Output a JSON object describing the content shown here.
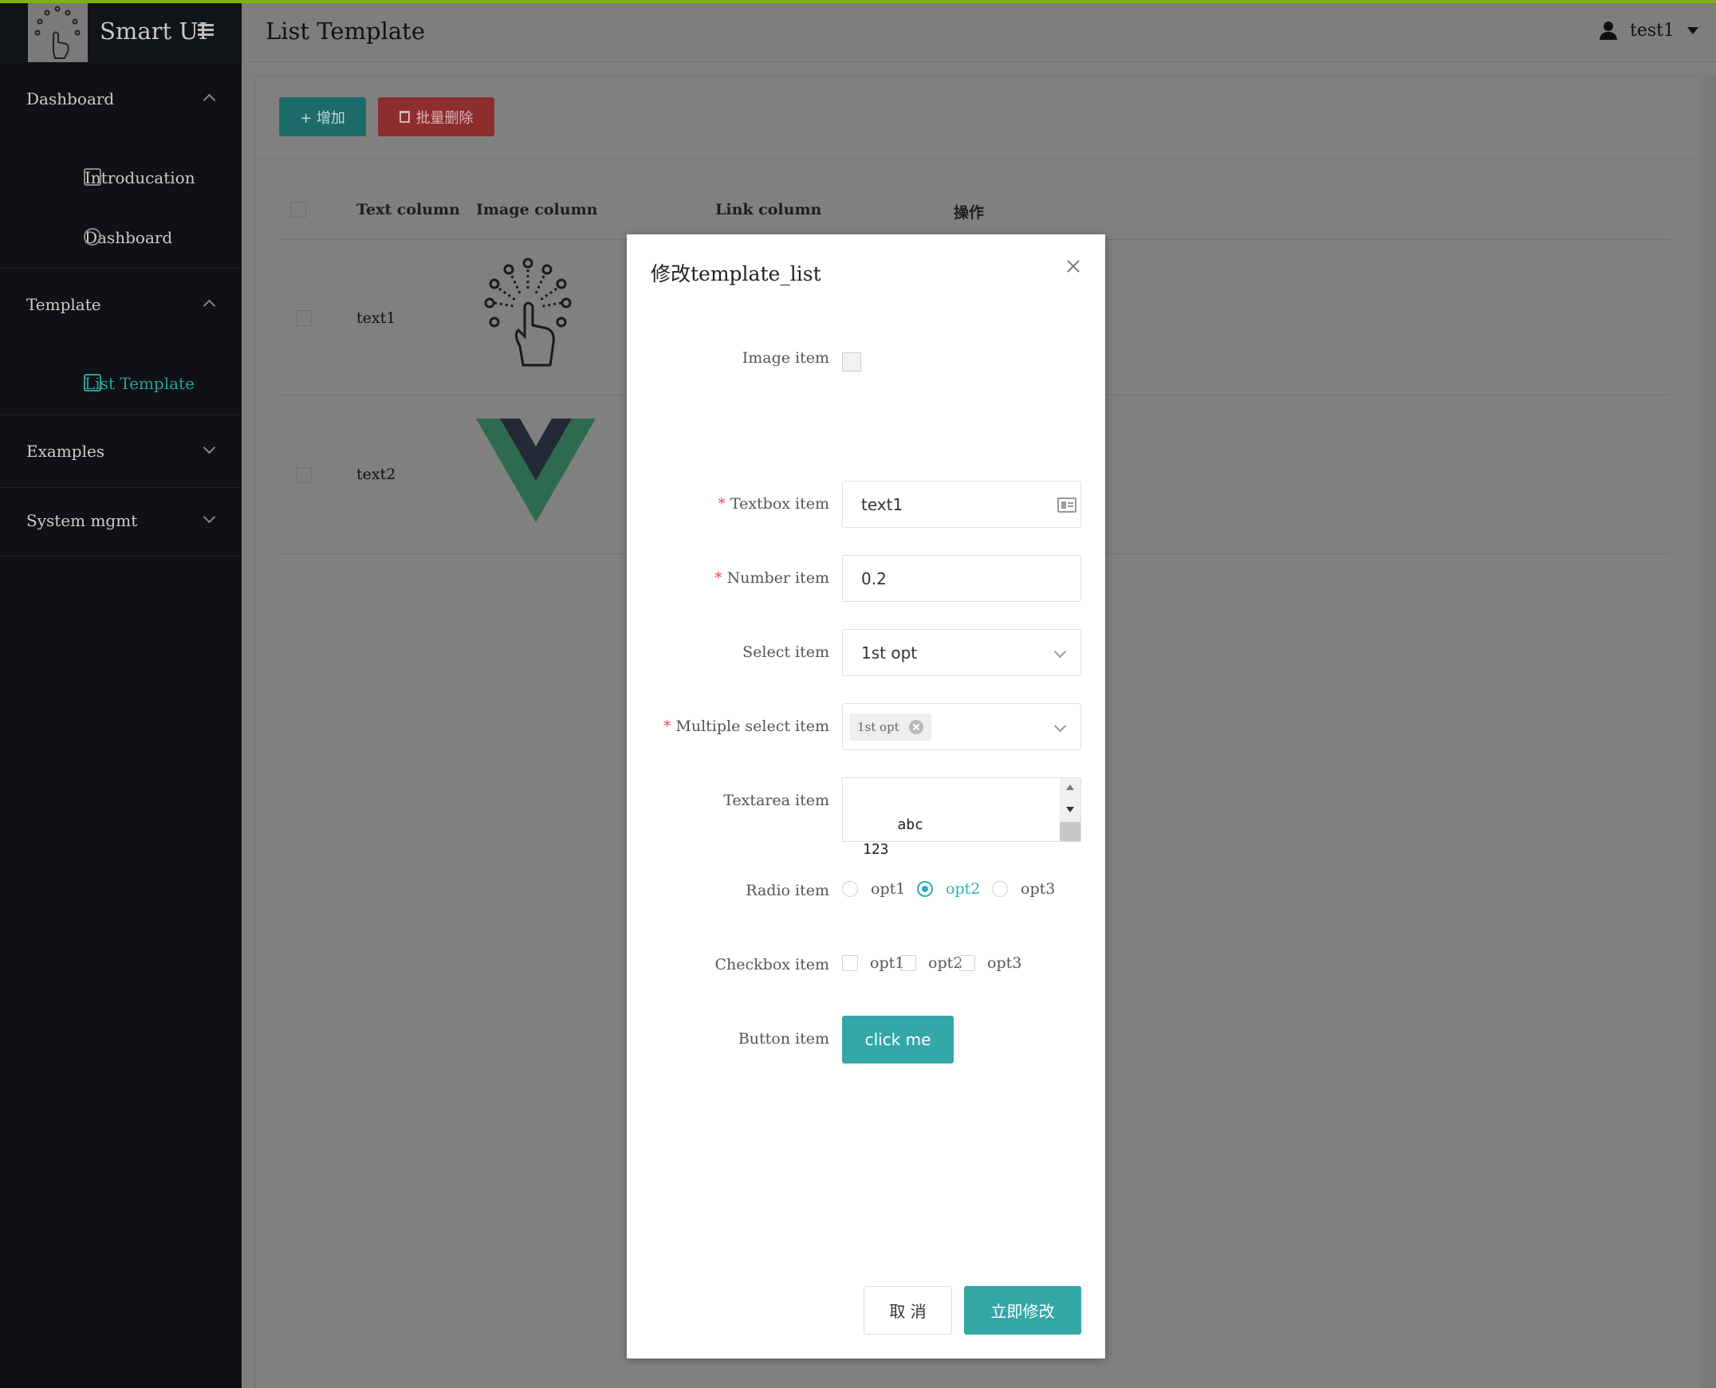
{
  "app": {
    "title": "Smart UI"
  },
  "sidebar": {
    "groups": [
      {
        "label": "Dashboard",
        "expanded": true,
        "items": [
          {
            "label": "Introducation",
            "icon": "presentation-chart-icon"
          },
          {
            "label": "Dashboard",
            "icon": "gauge-icon"
          }
        ]
      },
      {
        "label": "Template",
        "expanded": true,
        "items": [
          {
            "label": "List Template",
            "icon": "book-icon",
            "active": true
          }
        ]
      },
      {
        "label": "Examples",
        "expanded": false,
        "items": []
      },
      {
        "label": "System mgmt",
        "expanded": false,
        "items": []
      }
    ]
  },
  "header": {
    "page_title": "List Template",
    "user_name": "test1"
  },
  "toolbar": {
    "add_label": "+ 增加",
    "batch_delete_label": "批量删除"
  },
  "table": {
    "columns": [
      "Text column",
      "Image column",
      "Link column",
      "操作"
    ],
    "rows": [
      {
        "text": "text1",
        "image": "touch-hand-logo"
      },
      {
        "text": "text2",
        "image": "vue-logo"
      }
    ]
  },
  "modal": {
    "title": "修改template_list",
    "image_label": "Image item",
    "textbox_label": "Textbox item",
    "textbox_value": "text1",
    "number_label": "Number item",
    "number_value": "0.2",
    "select_label": "Select item",
    "select_value": "1st opt",
    "multi_label": "Multiple select item",
    "multi_tag": "1st opt",
    "textarea_label": "Textarea item",
    "textarea_value": "abc\n123",
    "radio_label": "Radio item",
    "radio_options": [
      "opt1",
      "opt2",
      "opt3"
    ],
    "radio_selected": "opt2",
    "checkbox_label": "Checkbox item",
    "checkbox_options": [
      "opt1",
      "opt2",
      "opt3"
    ],
    "button_label": "Button item",
    "button_text": "click me",
    "cancel": "取 消",
    "submit": "立即修改"
  },
  "colors": {
    "accent": "#35a7a7",
    "danger": "#e84a4a",
    "sidebar_bg": "#0f1114"
  }
}
